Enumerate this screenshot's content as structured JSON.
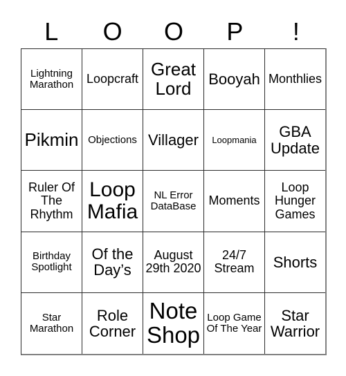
{
  "card": {
    "header_letters": [
      "L",
      "O",
      "O",
      "P",
      "!"
    ],
    "colors": {
      "background": "#ffffff",
      "text": "#000000",
      "grid_line": "#2b2b2b",
      "outer_shadow": "#808080"
    },
    "rows": [
      {
        "cells": [
          {
            "label": "Lightning Marathon",
            "size": "fs-s"
          },
          {
            "label": "Loopcraft",
            "size": "fs-m"
          },
          {
            "label": "Great Lord",
            "size": "fs-xl"
          },
          {
            "label": "Booyah",
            "size": "fs-l"
          },
          {
            "label": "Monthlies",
            "size": "fs-m"
          }
        ]
      },
      {
        "cells": [
          {
            "label": "Pikmin",
            "size": "fs-xl"
          },
          {
            "label": "Objections",
            "size": "fs-s"
          },
          {
            "label": "Villager",
            "size": "fs-l"
          },
          {
            "label": "Loopmania",
            "size": "fs-xs"
          },
          {
            "label": "GBA Update",
            "size": "fs-l"
          }
        ]
      },
      {
        "cells": [
          {
            "label": "Ruler Of The Rhythm",
            "size": "fs-m"
          },
          {
            "label": "Loop Mafia",
            "size": "fs-xxl"
          },
          {
            "label": "NL Error DataBase",
            "size": "fs-s"
          },
          {
            "label": "Moments",
            "size": "fs-m"
          },
          {
            "label": "Loop Hunger Games",
            "size": "fs-m"
          }
        ]
      },
      {
        "cells": [
          {
            "label": "Birthday Spotlight",
            "size": "fs-s"
          },
          {
            "label": "Of the Day’s",
            "size": "fs-l"
          },
          {
            "label": "August 29th 2020",
            "size": "fs-m"
          },
          {
            "label": "24/7 Stream",
            "size": "fs-m"
          },
          {
            "label": "Shorts",
            "size": "fs-l"
          }
        ]
      },
      {
        "cells": [
          {
            "label": "Star Marathon",
            "size": "fs-s"
          },
          {
            "label": "Role Corner",
            "size": "fs-l"
          },
          {
            "label": "Note Shop",
            "size": "fs-xxxl"
          },
          {
            "label": "Loop Game Of The Year",
            "size": "fs-s"
          },
          {
            "label": "Star Warrior",
            "size": "fs-l"
          }
        ]
      }
    ]
  }
}
